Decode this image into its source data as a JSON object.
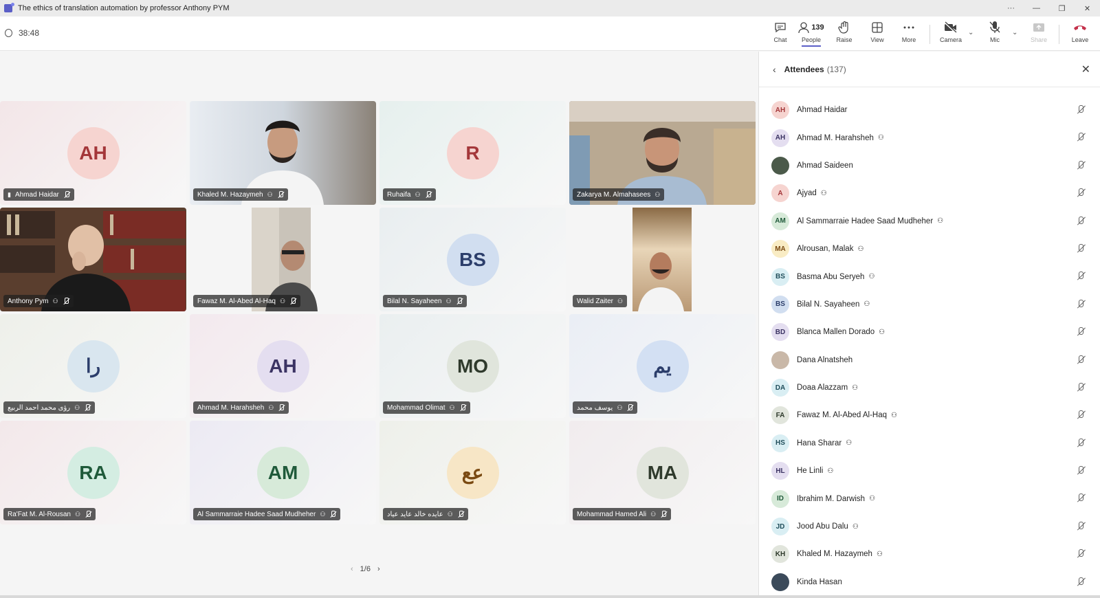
{
  "window": {
    "title": "The ethics of translation automation by professor Anthony PYM",
    "controls": [
      "···",
      "—",
      "❐",
      "✕"
    ]
  },
  "toolbar": {
    "timer": "38:48",
    "chat_label": "Chat",
    "people_label": "People",
    "people_count": "139",
    "raise_label": "Raise",
    "view_label": "View",
    "more_label": "More",
    "camera_label": "Camera",
    "mic_label": "Mic",
    "share_label": "Share",
    "leave_label": "Leave"
  },
  "grid": {
    "page": "1/6",
    "tiles": [
      {
        "name": "Ahmad Haidar",
        "initials": "AH",
        "type": "avatar",
        "avatar_bg": "#f6d4d0",
        "avatar_fg": "#a4373a",
        "tile_bg": "#f3e6e8"
      },
      {
        "name": "Khaled M. Hazaymeh",
        "type": "video"
      },
      {
        "name": "Ruhaifa",
        "initials": "R",
        "type": "avatar",
        "avatar_bg": "#f6d4d0",
        "avatar_fg": "#a4373a",
        "tile_bg": "#e6f0ee"
      },
      {
        "name": "Zakarya M. Almahasees",
        "type": "video",
        "speaking": true
      },
      {
        "name": "Anthony Pym",
        "type": "video"
      },
      {
        "name": "Fawaz M. Al-Abed Al-Haq",
        "type": "video-narrow"
      },
      {
        "name": "Bilal N. Sayaheen",
        "initials": "BS",
        "type": "avatar",
        "avatar_bg": "#d1def0",
        "avatar_fg": "#2c3e6b",
        "tile_bg": "#e9eef0"
      },
      {
        "name": "Walid Zaiter",
        "type": "video-narrow"
      },
      {
        "name": "رؤى محمد احمد الربيع",
        "initials": "را",
        "type": "avatar",
        "avatar_bg": "#d9e6ef",
        "avatar_fg": "#2c3e6b",
        "tile_bg": "#eef0ea"
      },
      {
        "name": "Ahmad M. Harahsheh",
        "initials": "AH",
        "type": "avatar",
        "avatar_bg": "#e4def0",
        "avatar_fg": "#3b3363",
        "tile_bg": "#f3e9ee"
      },
      {
        "name": "Mohammad Olimat",
        "initials": "MO",
        "type": "avatar",
        "avatar_bg": "#e0e5dc",
        "avatar_fg": "#2f3a2c",
        "tile_bg": "#eaeff0"
      },
      {
        "name": "يوسف محمد",
        "initials": "يم",
        "type": "avatar",
        "avatar_bg": "#d3e0f3",
        "avatar_fg": "#2c3e6b",
        "tile_bg": "#eaeef5"
      },
      {
        "name": "Ra'Fat M. Al-Rousan",
        "initials": "RA",
        "type": "avatar",
        "avatar_bg": "#d4ede2",
        "avatar_fg": "#1f5a3a",
        "tile_bg": "#f3e8ea"
      },
      {
        "name": "Al Sammarraie Hadee Saad Mudheher",
        "initials": "AM",
        "type": "avatar",
        "avatar_bg": "#d7ead9",
        "avatar_fg": "#1f5a3a",
        "tile_bg": "#eceaf3"
      },
      {
        "name": "عايده خالد عايد عياد",
        "initials": "عع",
        "type": "avatar",
        "avatar_bg": "#f7e6c6",
        "avatar_fg": "#7a4a12",
        "tile_bg": "#eef0ea"
      },
      {
        "name": "Mohammad Hamed Ali",
        "initials": "MA",
        "type": "avatar",
        "avatar_bg": "#e1e5dc",
        "avatar_fg": "#2f3a2c",
        "tile_bg": "#f1ecee"
      }
    ]
  },
  "panel": {
    "title": "Attendees",
    "count": "(137)",
    "attendees": [
      {
        "initials": "AH",
        "name": "Ahmad Haidar",
        "org": false,
        "bg": "#f6d4d0",
        "fg": "#a4373a"
      },
      {
        "initials": "AH",
        "name": "Ahmad M. Harahsheh",
        "org": true,
        "bg": "#e4def0",
        "fg": "#3b3363"
      },
      {
        "initials": "",
        "name": "Ahmad Saideen",
        "org": false,
        "bg": "#4b5a4a",
        "fg": "#fff",
        "photo": true
      },
      {
        "initials": "A",
        "name": "Ajyad",
        "org": true,
        "bg": "#f6d4d0",
        "fg": "#a4373a"
      },
      {
        "initials": "AM",
        "name": "Al Sammarraie Hadee Saad Mudheher",
        "org": true,
        "bg": "#d7ead9",
        "fg": "#1f5a3a"
      },
      {
        "initials": "MA",
        "name": "Alrousan, Malak",
        "org": true,
        "bg": "#f9ecc4",
        "fg": "#7a4a12"
      },
      {
        "initials": "BS",
        "name": "Basma Abu Seryeh",
        "org": true,
        "bg": "#d9eef3",
        "fg": "#1f4d5a"
      },
      {
        "initials": "BS",
        "name": "Bilal N. Sayaheen",
        "org": true,
        "bg": "#d1def0",
        "fg": "#2c3e6b"
      },
      {
        "initials": "BD",
        "name": "Blanca Mallen Dorado",
        "org": true,
        "bg": "#e4def0",
        "fg": "#3b3363"
      },
      {
        "initials": "",
        "name": "Dana Alnatsheh",
        "org": false,
        "bg": "#c9b8a8",
        "fg": "#fff",
        "photo": true
      },
      {
        "initials": "DA",
        "name": "Doaa Alazzam",
        "org": true,
        "bg": "#d9eef3",
        "fg": "#1f4d5a"
      },
      {
        "initials": "FA",
        "name": "Fawaz M. Al-Abed Al-Haq",
        "org": true,
        "bg": "#e1e5dc",
        "fg": "#2f3a2c"
      },
      {
        "initials": "HS",
        "name": "Hana Sharar",
        "org": true,
        "bg": "#d9eef3",
        "fg": "#1f4d5a"
      },
      {
        "initials": "HL",
        "name": "He Linli",
        "org": true,
        "bg": "#e4def0",
        "fg": "#3b3363"
      },
      {
        "initials": "ID",
        "name": "Ibrahim M. Darwish",
        "org": true,
        "bg": "#d7ead9",
        "fg": "#1f5a3a"
      },
      {
        "initials": "JD",
        "name": "Jood Abu Dalu",
        "org": true,
        "bg": "#d9eef3",
        "fg": "#1f4d5a"
      },
      {
        "initials": "KH",
        "name": "Khaled M. Hazaymeh",
        "org": true,
        "bg": "#e1e5dc",
        "fg": "#2f3a2c"
      },
      {
        "initials": "",
        "name": "Kinda Hasan",
        "org": false,
        "bg": "#3b4a5a",
        "fg": "#fff",
        "photo": true
      }
    ]
  }
}
